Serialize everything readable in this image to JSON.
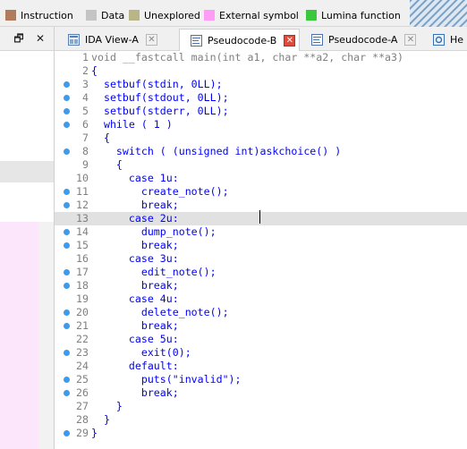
{
  "legend": [
    {
      "label": "Instruction",
      "color": "#b07c5c"
    },
    {
      "label": "Data",
      "color": "#c4c4c4"
    },
    {
      "label": "Unexplored",
      "color": "#b8b688"
    },
    {
      "label": "External symbol",
      "color": "#ff9cf5"
    },
    {
      "label": "Lumina function",
      "color": "#3cc83c"
    }
  ],
  "left_panel": {
    "float_icon": "restore-icon",
    "close_label": "✕"
  },
  "tabs": [
    {
      "label": "IDA View-A",
      "icon": "graph-icon",
      "active": false
    },
    {
      "label": "Pseudocode-B",
      "icon": "pseudocode-icon",
      "active": true
    },
    {
      "label": "Pseudocode-A",
      "icon": "pseudocode-icon",
      "active": false
    },
    {
      "label": "He",
      "icon": "hex-icon",
      "active": false
    }
  ],
  "code": {
    "lines": [
      {
        "num": "1",
        "text": "void __fastcall main(int a1, char **a2, char **a3)",
        "bp": false
      },
      {
        "num": "2",
        "text": "{",
        "bp": false
      },
      {
        "num": "3",
        "text": "  setbuf(stdin, 0LL);",
        "bp": true
      },
      {
        "num": "4",
        "text": "  setbuf(stdout, 0LL);",
        "bp": true
      },
      {
        "num": "5",
        "text": "  setbuf(stderr, 0LL);",
        "bp": true
      },
      {
        "num": "6",
        "text": "  while ( 1 )",
        "bp": true
      },
      {
        "num": "7",
        "text": "  {",
        "bp": false
      },
      {
        "num": "8",
        "text": "    switch ( (unsigned int)askchoice() )",
        "bp": true
      },
      {
        "num": "9",
        "text": "    {",
        "bp": false
      },
      {
        "num": "10",
        "text": "      case 1u:",
        "bp": false
      },
      {
        "num": "11",
        "text": "        create_note();",
        "bp": true
      },
      {
        "num": "12",
        "text": "        break;",
        "bp": true
      },
      {
        "num": "13",
        "text": "      case 2u:",
        "bp": false
      },
      {
        "num": "14",
        "text": "        dump_note();",
        "bp": true
      },
      {
        "num": "15",
        "text": "        break;",
        "bp": true
      },
      {
        "num": "16",
        "text": "      case 3u:",
        "bp": false
      },
      {
        "num": "17",
        "text": "        edit_note();",
        "bp": true
      },
      {
        "num": "18",
        "text": "        break;",
        "bp": true
      },
      {
        "num": "19",
        "text": "      case 4u:",
        "bp": false
      },
      {
        "num": "20",
        "text": "        delete_note();",
        "bp": true
      },
      {
        "num": "21",
        "text": "        break;",
        "bp": true
      },
      {
        "num": "22",
        "text": "      case 5u:",
        "bp": false
      },
      {
        "num": "23",
        "text": "        exit(0);",
        "bp": true
      },
      {
        "num": "24",
        "text": "      default:",
        "bp": false
      },
      {
        "num": "25",
        "text": "        puts(\"invalid\");",
        "bp": true
      },
      {
        "num": "26",
        "text": "        break;",
        "bp": true
      },
      {
        "num": "27",
        "text": "    }",
        "bp": false
      },
      {
        "num": "28",
        "text": "  }",
        "bp": false
      },
      {
        "num": "29",
        "text": "}",
        "bp": true
      }
    ],
    "highlighted_line": "13"
  }
}
